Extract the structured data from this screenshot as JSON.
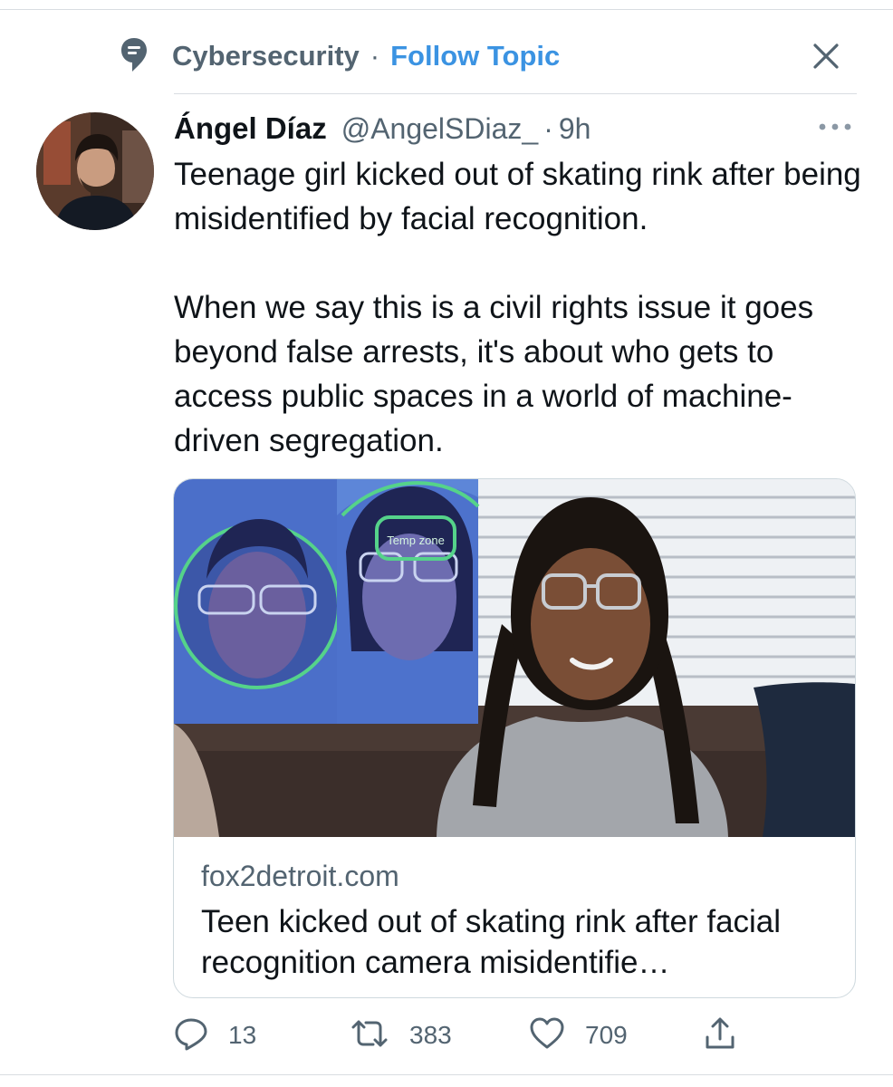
{
  "topic": {
    "name": "Cybersecurity",
    "separator": "·",
    "follow_label": "Follow Topic"
  },
  "tweet": {
    "author_name": "Ángel Díaz",
    "handle": "@AngelSDiaz_",
    "time_separator": "·",
    "time": "9h",
    "paragraphs": [
      "Teenage girl kicked out of skating rink after being misidentified by facial recognition.",
      "When we say this is a civil rights issue it goes beyond false arrests, it's about who gets to access public spaces in a world of machine-driven segregation."
    ]
  },
  "card": {
    "image_overlay_text": "Temp zone",
    "domain": "fox2detroit.com",
    "title": "Teen kicked out of skating rink after facial recognition camera misidentifie…"
  },
  "actions": {
    "reply_count": "13",
    "retweet_count": "383",
    "like_count": "709"
  },
  "icons": {
    "topic": "topic-speech-bubble-icon",
    "close": "close-icon",
    "more": "more-dots-icon",
    "reply": "reply-icon",
    "retweet": "retweet-icon",
    "like": "heart-icon",
    "share": "share-icon"
  },
  "colors": {
    "accent": "#3b93e2",
    "secondary_text": "#536471",
    "primary_text": "#0f1419",
    "border": "#cfd9de"
  }
}
